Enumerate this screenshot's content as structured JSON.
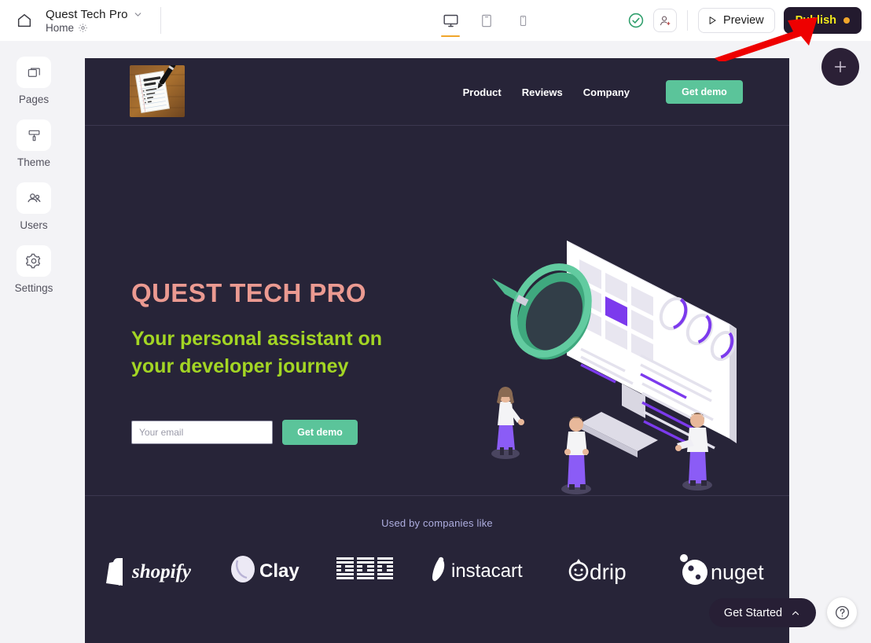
{
  "topbar": {
    "home_icon": "home-icon",
    "site_title": "Quest Tech Pro",
    "title_chevron": "chevron-down-icon",
    "page_name": "Home",
    "page_settings_icon": "gear-icon",
    "devices": [
      {
        "name": "desktop",
        "icon": "desktop-icon",
        "active": true
      },
      {
        "name": "tablet",
        "icon": "tablet-icon",
        "active": false
      },
      {
        "name": "mobile",
        "icon": "mobile-icon",
        "active": false
      }
    ],
    "saved_status_icon": "check-circle-icon",
    "invite_icon": "add-user-icon",
    "preview_label": "Preview",
    "preview_icon": "play-icon",
    "publish_label": "Publish",
    "publish_dot_color": "#f0a62b",
    "publish_bg": "#231a2e",
    "publish_text_color": "#f2ea1c"
  },
  "sidebar": {
    "items": [
      {
        "label": "Pages",
        "icon": "pages-icon"
      },
      {
        "label": "Theme",
        "icon": "paint-roller-icon"
      },
      {
        "label": "Users",
        "icon": "users-icon"
      },
      {
        "label": "Settings",
        "icon": "gear-icon"
      }
    ]
  },
  "site": {
    "background": "#272438",
    "logo_alt": "notepad-and-pen-photo",
    "nav": [
      {
        "label": "Product"
      },
      {
        "label": "Reviews"
      },
      {
        "label": "Company"
      }
    ],
    "header_cta": "Get demo",
    "hero": {
      "title": "QUEST TECH PRO",
      "title_color": "#eb9a91",
      "subtitle_line1": "Your personal assistant on",
      "subtitle_line2": "your developer journey",
      "subtitle_color": "#a3d524",
      "email_placeholder": "Your email",
      "email_value": "",
      "cta_label": "Get demo",
      "cta_color": "#5bc49a",
      "illustration": "isometric-monitor-magnifier-people"
    },
    "logos_section": {
      "heading": "Used by companies like",
      "heading_color": "#aeaee0",
      "logos": [
        {
          "name": "shopify",
          "label": "shopify"
        },
        {
          "name": "clay",
          "label": "Clay"
        },
        {
          "name": "ibm",
          "label": "IBM"
        },
        {
          "name": "instacart",
          "label": "instacart"
        },
        {
          "name": "drip",
          "label": "drip"
        },
        {
          "name": "nuget",
          "label": "nuget"
        }
      ]
    }
  },
  "overlays": {
    "add_section_icon": "plus-icon",
    "get_started_label": "Get Started",
    "get_started_chevron": "chevron-up-icon",
    "help_label": "?",
    "annotation": "red-arrow-pointing-to-publish"
  }
}
